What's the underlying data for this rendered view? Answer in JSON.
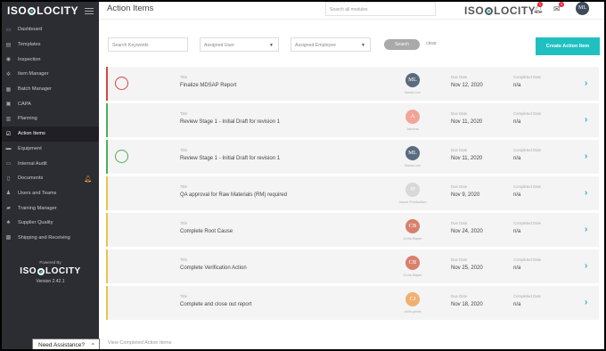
{
  "app": {
    "brand": "ISOLOCITY",
    "page_title": "Action Items",
    "search_placeholder": "Search all modules",
    "notif_count": "1",
    "tasks_count": "4",
    "user_initials": "ML"
  },
  "sidebar": {
    "items": [
      {
        "label": "Dashboard",
        "icon": "dashboard-icon",
        "glyph": "▭"
      },
      {
        "label": "Templates",
        "icon": "templates-icon",
        "glyph": "▤"
      },
      {
        "label": "Inspection",
        "icon": "eye-icon",
        "glyph": "◉"
      },
      {
        "label": "Item Manager",
        "icon": "gear-icon",
        "glyph": "✲"
      },
      {
        "label": "Batch Manager",
        "icon": "batch-icon",
        "glyph": "▦"
      },
      {
        "label": "CAPA",
        "icon": "capa-icon",
        "glyph": "▣"
      },
      {
        "label": "Planning",
        "icon": "map-icon",
        "glyph": "▥"
      },
      {
        "label": "Action Items",
        "icon": "checkbox-icon",
        "glyph": "☑"
      },
      {
        "label": "Equipment",
        "icon": "equipment-icon",
        "glyph": "▬"
      },
      {
        "label": "Internal Audit",
        "icon": "audit-icon",
        "glyph": "▭"
      },
      {
        "label": "Documents",
        "icon": "document-icon",
        "glyph": "▯"
      },
      {
        "label": "Users and Teams",
        "icon": "users-icon",
        "glyph": "♟"
      },
      {
        "label": "Training Manager",
        "icon": "training-icon",
        "glyph": "▰"
      },
      {
        "label": "Supplier Quality",
        "icon": "supplier-icon",
        "glyph": "♣"
      },
      {
        "label": "Shipping and Receiving",
        "icon": "shipping-icon",
        "glyph": "▩"
      }
    ],
    "powered_by": "Powered By",
    "version": "Version 2.42.1"
  },
  "assist": {
    "label": "Need Assistance?",
    "chevron": "⌃"
  },
  "filters": {
    "keywords_placeholder": "Search Keywords",
    "assigned_user": "Assigned User",
    "assigned_employee": "Assigned Employee",
    "search_label": "Search",
    "clear_label": "clear",
    "create_label": "Create Action Item"
  },
  "labels": {
    "title": "Title",
    "due_date": "Due Date",
    "completed_date": "Completed Date"
  },
  "items": [
    {
      "title": "Finalize MDSAP Report",
      "initials": "ML",
      "assignee": "Maria Lee",
      "due": "Nov 12, 2020",
      "completed": "n/a",
      "stripe": "#d9443b",
      "circle": "#d9443b",
      "avatar_bg": "#596b7e",
      "has_circle": true
    },
    {
      "title": "Review Stage 1 - Initial Draft for revision 1",
      "initials": "A",
      "assignee": "Admins",
      "due": "Nov 11, 2020",
      "completed": "n/a",
      "stripe": "#4caf50",
      "circle": "",
      "avatar_bg": "#f2a596",
      "has_circle": false
    },
    {
      "title": "Review Stage 1 - Initial Draft for revision 1",
      "initials": "ML",
      "assignee": "Maria Lee",
      "due": "Nov 11, 2020",
      "completed": "n/a",
      "stripe": "#4caf50",
      "circle": "#4caf50",
      "avatar_bg": "#596b7e",
      "has_circle": true
    },
    {
      "title": "QA approval for Raw Materials (RM) required",
      "initials": "JP",
      "assignee": "Jason Production",
      "due": "Nov 9, 2020",
      "completed": "n/a",
      "stripe": "#f0c24b",
      "circle": "",
      "avatar_bg": "#d8d8d8",
      "has_circle": false
    },
    {
      "title": "Complete Root Cause",
      "initials": "CB",
      "assignee": "Chris Bayer",
      "due": "Nov 24, 2020",
      "completed": "n/a",
      "stripe": "#f0c24b",
      "circle": "",
      "avatar_bg": "#d9806c",
      "has_circle": false
    },
    {
      "title": "Complete Verification Action",
      "initials": "CB",
      "assignee": "Chris Bayer",
      "due": "Nov 25, 2020",
      "completed": "n/a",
      "stripe": "#f0c24b",
      "circle": "",
      "avatar_bg": "#d9806c",
      "has_circle": false
    },
    {
      "title": "Complete and close out report",
      "initials": "CJ",
      "assignee": "chris jones",
      "due": "Nov 18, 2020",
      "completed": "n/a",
      "stripe": "#f0c24b",
      "circle": "",
      "avatar_bg": "#f2b070",
      "has_circle": false
    }
  ],
  "footer": {
    "view_completed": "View Completed Action Items"
  }
}
